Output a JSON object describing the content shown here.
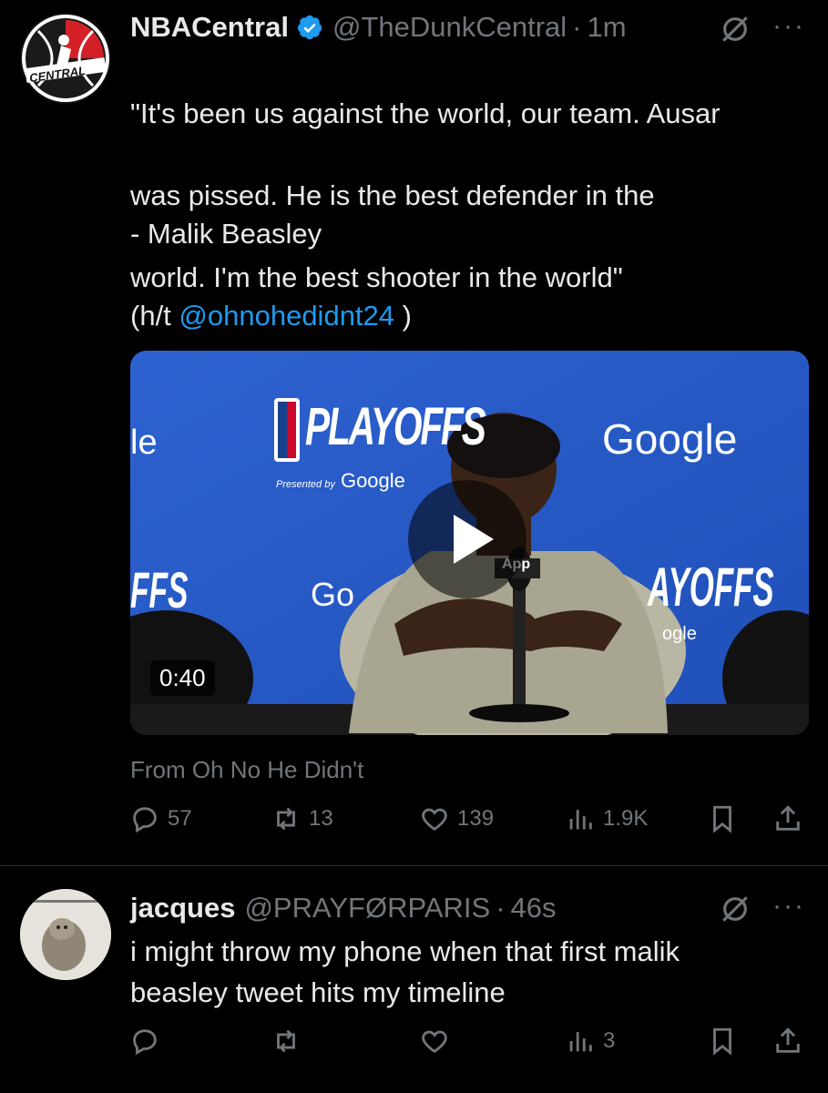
{
  "tweet1": {
    "name": "NBACentral",
    "handle": "@TheDunkCentral",
    "separator": "·",
    "time": "1m",
    "avatar_text": "CENTRAL",
    "body_lines": [
      "\"It's been us against the world, our team. Ausar",
      "was pissed. He is the best defender in the",
      "world. I'm the best shooter in the world\""
    ],
    "attribution": "- Malik Beasley",
    "ht_prefix": "(h/t ",
    "ht_link": "@ohnohedidnt24",
    "ht_suffix": " )",
    "video": {
      "duration": "0:40",
      "banner_left": "PLAYOFFS",
      "presented_by": "Presented by",
      "google": "Google",
      "google_right": "Google",
      "left_partial_top": "le",
      "left_partial": "FFS",
      "right_partial": "AYOFFS",
      "right_google_partial": "ogle",
      "mid_partial": "Go",
      "mic_label": "App"
    },
    "from": "From Oh No He Didn't",
    "replies": "57",
    "retweets": "13",
    "likes": "139",
    "views": "1.9K"
  },
  "tweet2": {
    "name": "jacques",
    "handle": "@PRAYFØRPARIS",
    "separator": "·",
    "time": "46s",
    "body": "i might throw my phone when that first malik\nbeasley tweet hits my timeline",
    "replies": "",
    "retweets": "",
    "likes": "",
    "views": "3"
  },
  "icons": {
    "verified": "verified-badge-icon",
    "grok": "grok-icon",
    "more": "more-icon",
    "reply": "reply-icon",
    "retweet": "retweet-icon",
    "like": "like-icon",
    "views": "views-icon",
    "bookmark": "bookmark-icon",
    "share": "share-icon"
  },
  "colors": {
    "link": "#1d9bf0",
    "verified": "#1d9bf0",
    "muted": "#71767b",
    "text": "#e7e9ea",
    "background": "#000000"
  }
}
